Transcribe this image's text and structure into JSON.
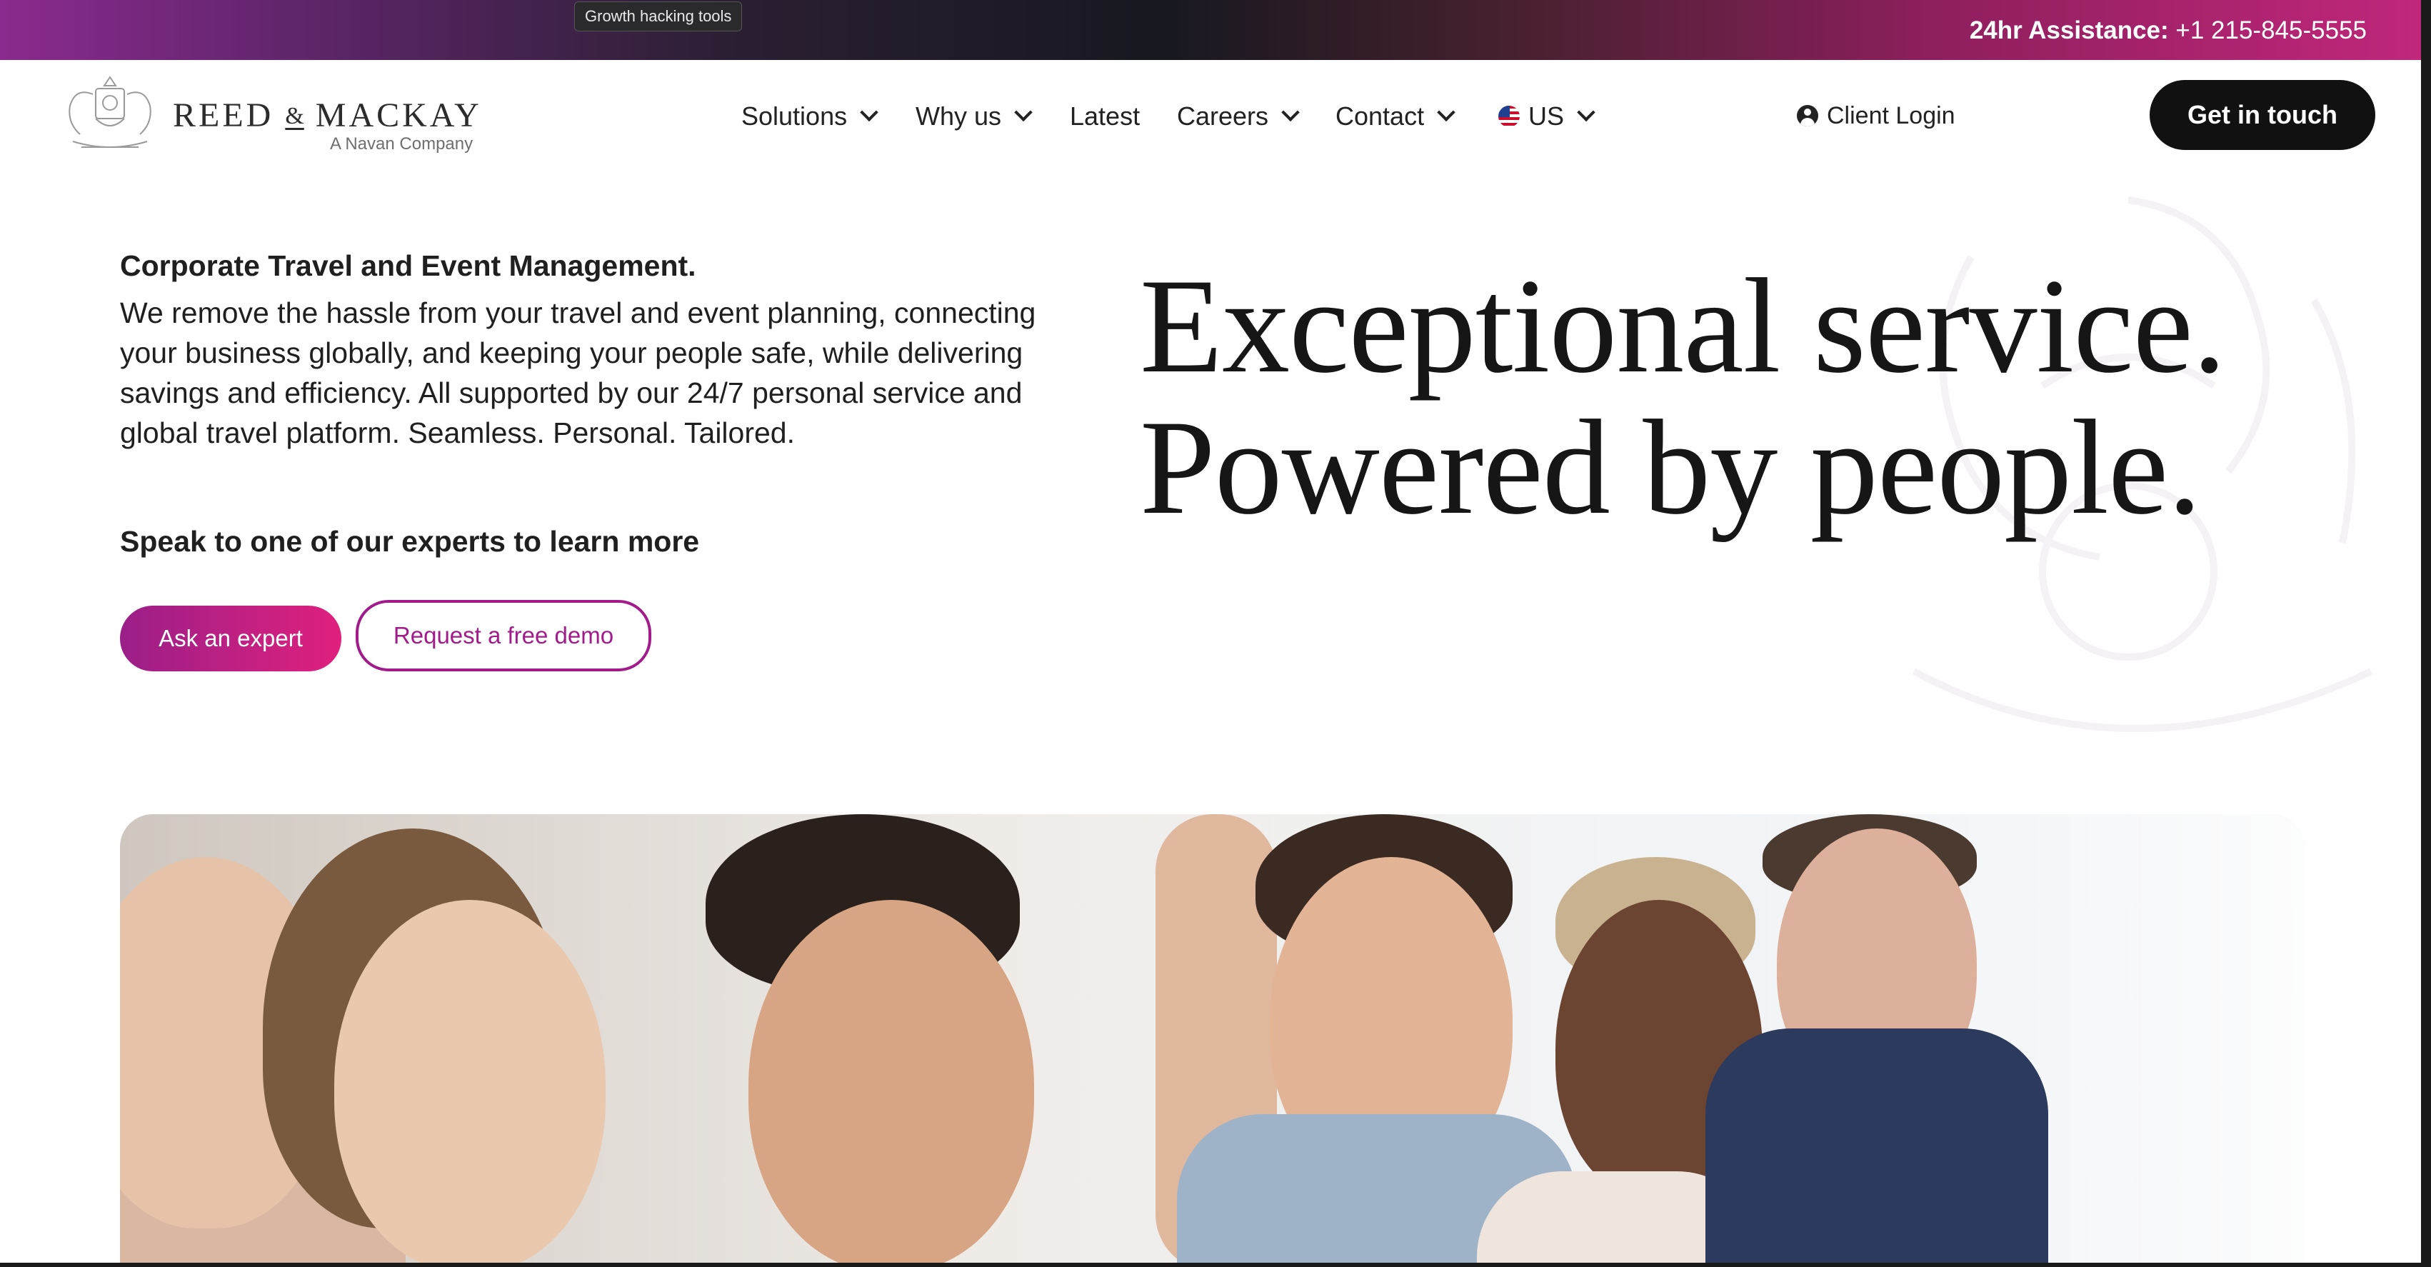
{
  "topbar": {
    "tooltip": "Growth hacking tools",
    "assist_label": "24hr Assistance:",
    "assist_phone": "+1 215-845-5555"
  },
  "brand": {
    "name_left": "REED",
    "ampersand": "&",
    "name_right": "MACKAY",
    "tagline": "A Navan Company",
    "logo_icon": "crest-logo"
  },
  "nav": {
    "items": [
      {
        "label": "Solutions",
        "dropdown": true
      },
      {
        "label": "Why us",
        "dropdown": true
      },
      {
        "label": "Latest",
        "dropdown": false
      },
      {
        "label": "Careers",
        "dropdown": true
      },
      {
        "label": "Contact",
        "dropdown": true
      },
      {
        "label": "US",
        "dropdown": true,
        "icon": "us-flag-icon"
      }
    ],
    "login_label": "Client Login",
    "login_icon": "user-circle-icon",
    "cta_label": "Get in touch"
  },
  "hero": {
    "subheading": "Corporate Travel and Event Management.",
    "body": "We remove the hassle from your travel and event planning, connecting your business globally, and keeping your people safe, while delivering savings and efficiency. All supported by our 24/7 personal service and global travel platform. Seamless. Personal. Tailored.",
    "speak": "Speak to one of our experts to learn more",
    "ask_button": "Ask an expert",
    "demo_button": "Request a free demo",
    "headline_line1": "Exceptional service.",
    "headline_line2": "Powered by people."
  },
  "colors": {
    "accent": "#a11c8a",
    "accent_gradient_end": "#e0207d",
    "dark_button": "#111111"
  }
}
